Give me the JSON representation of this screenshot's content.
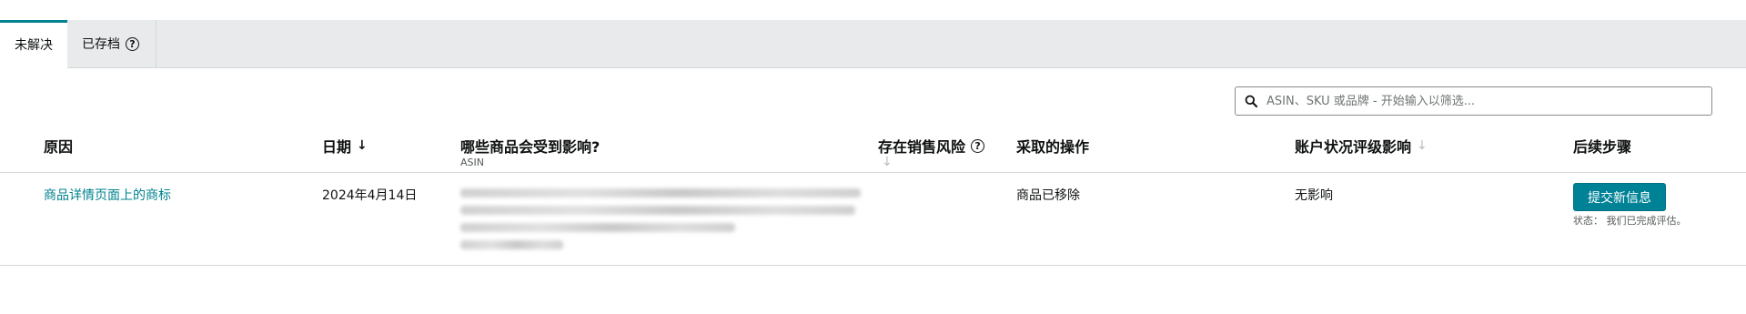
{
  "tabs": {
    "unresolved": "未解决",
    "archived": "已存档"
  },
  "search": {
    "placeholder": "ASIN、SKU 或品牌 - 开始输入以筛选..."
  },
  "table": {
    "headers": {
      "reason": "原因",
      "date": "日期",
      "affected": "哪些商品会受到影响?",
      "affected_sub": "ASIN",
      "at_risk": "存在销售风险",
      "action_taken": "采取的操作",
      "health_impact": "账户状况评级影响",
      "next_steps": "后续步骤"
    },
    "rows": [
      {
        "reason": "商品详情页面上的商标",
        "date": "2024年4月14日",
        "action_taken": "商品已移除",
        "health_impact": "无影响",
        "next_step_button": "提交新信息",
        "status_label": "状态：",
        "status_value": "我们已完成评估。"
      }
    ]
  },
  "icons": {
    "help": "help-circle-icon",
    "search": "search-icon",
    "sort_desc": "arrow-down-icon"
  },
  "colors": {
    "accent": "#00838f",
    "button": "#008296",
    "tabbar": "#e9eaec"
  }
}
